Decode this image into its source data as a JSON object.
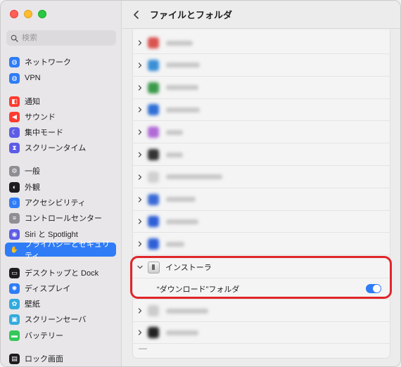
{
  "window": {
    "title": "ファイルとフォルダ"
  },
  "search": {
    "placeholder": "検索"
  },
  "sidebar": {
    "items": [
      {
        "label": "ネットワーク",
        "icon": "network-icon",
        "color": "#2f7cf6"
      },
      {
        "label": "VPN",
        "icon": "vpn-icon",
        "color": "#2f7cf6"
      },
      {
        "label": "通知",
        "icon": "notification-icon",
        "color": "#ff3b30"
      },
      {
        "label": "サウンド",
        "icon": "sound-icon",
        "color": "#ff3b30"
      },
      {
        "label": "集中モード",
        "icon": "focus-icon",
        "color": "#5e5ce6"
      },
      {
        "label": "スクリーンタイム",
        "icon": "screen-time-icon",
        "color": "#5e5ce6"
      },
      {
        "label": "一般",
        "icon": "gear-icon",
        "color": "#8e8e93"
      },
      {
        "label": "外観",
        "icon": "appearance-icon",
        "color": "#1d1d1f"
      },
      {
        "label": "アクセシビリティ",
        "icon": "accessibility-icon",
        "color": "#2f7cf6"
      },
      {
        "label": "コントロールセンター",
        "icon": "control-center-icon",
        "color": "#8e8e93"
      },
      {
        "label": "Siri と Spotlight",
        "icon": "siri-icon",
        "color": "#5e5ce6"
      },
      {
        "label": "プライバシーとセキュリティ",
        "icon": "hand-icon",
        "color": "#2f7cf6",
        "selected": true
      },
      {
        "label": "デスクトップと Dock",
        "icon": "dock-icon",
        "color": "#1d1d1f"
      },
      {
        "label": "ディスプレイ",
        "icon": "display-icon",
        "color": "#2f7cf6"
      },
      {
        "label": "壁紙",
        "icon": "wallpaper-icon",
        "color": "#34aadc"
      },
      {
        "label": "スクリーンセーバ",
        "icon": "screensaver-icon",
        "color": "#34aadc"
      },
      {
        "label": "バッテリー",
        "icon": "battery-icon",
        "color": "#34c759"
      },
      {
        "label": "ロック画面",
        "icon": "lock-screen-icon",
        "color": "#1d1d1f"
      }
    ]
  },
  "apps": {
    "blurred_rows": [
      {
        "icon_color": "#d9534f"
      },
      {
        "icon_color": "#3a8fd6"
      },
      {
        "icon_color": "#3a9a4a"
      },
      {
        "icon_color": "#2f6fd6"
      },
      {
        "icon_color": "#b06ad6"
      },
      {
        "icon_color": "#333333"
      },
      {
        "icon_color": "#d0d0d0"
      },
      {
        "icon_color": "#3a6ad6"
      },
      {
        "icon_color": "#2f5fd6"
      },
      {
        "icon_color": "#2f5fd6"
      }
    ],
    "installer": {
      "name": "インストーラ",
      "folder_label": "“ダウンロード”フォルダ",
      "toggle_on": true
    },
    "blurred_after": [
      {
        "icon_color": "#cccccc"
      },
      {
        "icon_color": "#222222"
      }
    ],
    "footer_label": "—"
  },
  "colors": {
    "accent": "#2f7cf6",
    "highlight": "#e0262a"
  }
}
